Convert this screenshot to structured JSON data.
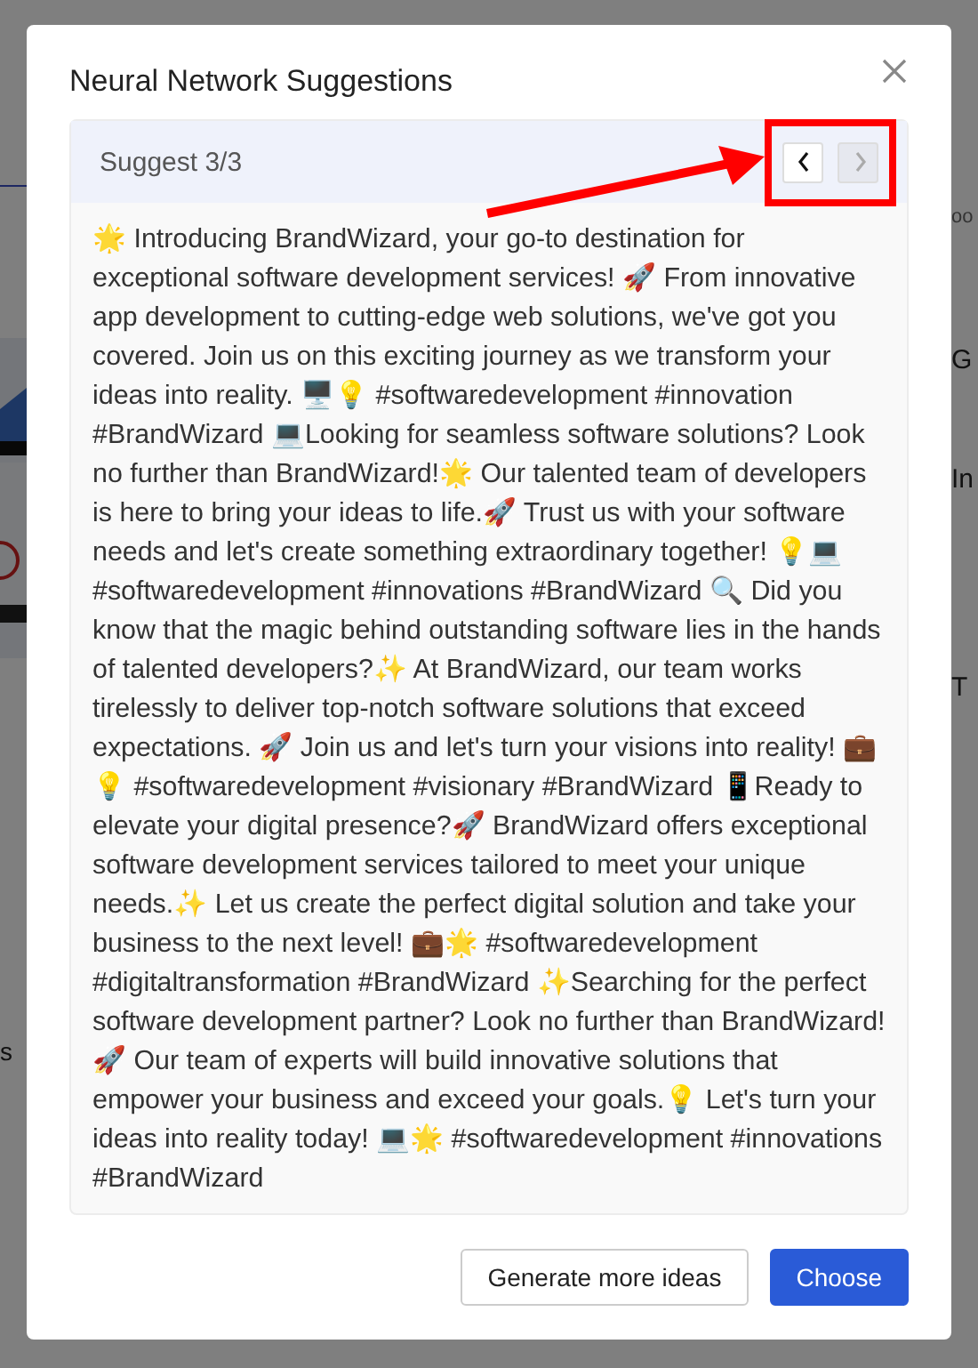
{
  "background": {
    "left_texts": [
      "s"
    ],
    "right_texts": [
      "oo",
      "G",
      "In",
      "T"
    ]
  },
  "dialog": {
    "title": "Neural Network Suggestions",
    "suggestion": {
      "counter": "Suggest 3/3",
      "previous": {
        "disabled": false
      },
      "next": {
        "disabled": true
      },
      "text": "🌟 Introducing BrandWizard, your go-to destination for exceptional software development services! 🚀 From innovative app development to cutting-edge web solutions, we've got you covered. Join us on this exciting journey as we transform your ideas into reality. 🖥️💡 #softwaredevelopment #innovation #BrandWizard 💻Looking for seamless software solutions? Look no further than BrandWizard!🌟 Our talented team of developers is here to bring your ideas to life.🚀 Trust us with your software needs and let's create something extraordinary together! 💡💻 #softwaredevelopment #innovations #BrandWizard 🔍 Did you know that the magic behind outstanding software lies in the hands of talented developers?✨ At BrandWizard, our team works tirelessly to deliver top-notch software solutions that exceed expectations. 🚀 Join us and let's turn your visions into reality! 💼💡 #softwaredevelopment #visionary #BrandWizard 📱Ready to elevate your digital presence?🚀 BrandWizard offers exceptional software development services tailored to meet your unique needs.✨ Let us create the perfect digital solution and take your business to the next level! 💼🌟 #softwaredevelopment #digitaltransformation #BrandWizard ✨Searching for the perfect software development partner? Look no further than BrandWizard! 🚀 Our team of experts will build innovative solutions that empower your business and exceed your goals.💡 Let's turn your ideas into reality today! 💻🌟 #softwaredevelopment #innovations #BrandWizard"
    },
    "buttons": [
      {
        "label": "Generate more ideas",
        "kind": "secondary"
      },
      {
        "label": "Choose",
        "kind": "primary"
      }
    ]
  }
}
